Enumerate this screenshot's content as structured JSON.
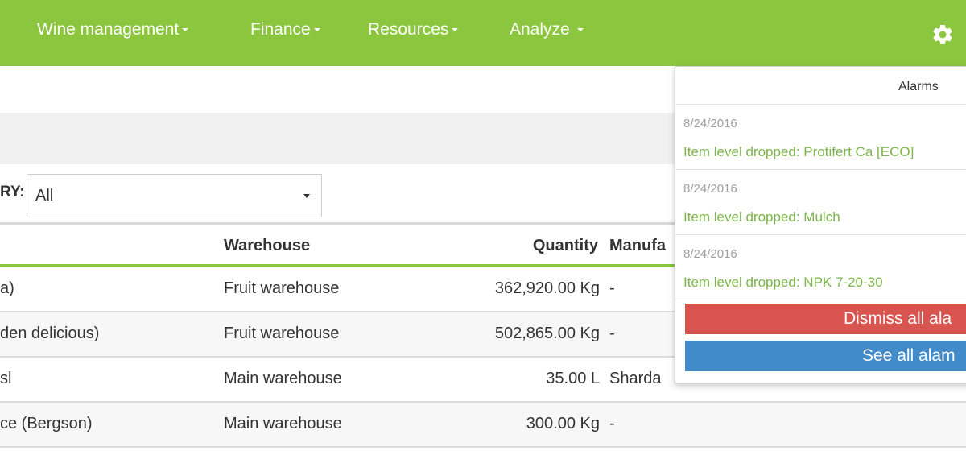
{
  "nav": {
    "items": [
      {
        "label": "Wine management"
      },
      {
        "label": "Finance"
      },
      {
        "label": "Resources"
      },
      {
        "label": "Analyze"
      }
    ]
  },
  "filter": {
    "label": "RY:",
    "value": "All"
  },
  "table": {
    "headers": {
      "warehouse": "Warehouse",
      "quantity": "Quantity",
      "manufacturer": "Manufa"
    },
    "rows": [
      {
        "name": "a)",
        "warehouse": "Fruit warehouse",
        "quantity": "362,920.00 Kg",
        "manufacturer": "-"
      },
      {
        "name": "den delicious)",
        "warehouse": "Fruit warehouse",
        "quantity": "502,865.00 Kg",
        "manufacturer": "-"
      },
      {
        "name": "sl",
        "warehouse": "Main warehouse",
        "quantity": "35.00 L",
        "manufacturer": "Sharda"
      },
      {
        "name": "ce (Bergson)",
        "warehouse": "Main warehouse",
        "quantity": "300.00 Kg",
        "manufacturer": "-"
      }
    ]
  },
  "alarms": {
    "title": "Alarms",
    "items": [
      {
        "date": "8/24/2016",
        "text": "Item level dropped: Protifert Ca [ECO]"
      },
      {
        "date": "8/24/2016",
        "text": "Item level dropped: Mulch"
      },
      {
        "date": "8/24/2016",
        "text": "Item level dropped: NPK 7-20-30"
      }
    ],
    "dismiss_label": "Dismiss all ala",
    "see_label": "See all alam"
  },
  "colors": {
    "brand": "#8cc63f",
    "alarm_text": "#7ab648",
    "dismiss": "#d9534f",
    "see_all": "#428bca"
  },
  "icons": {
    "settings": "gear-icon",
    "dropdown": "caret-down-icon"
  }
}
